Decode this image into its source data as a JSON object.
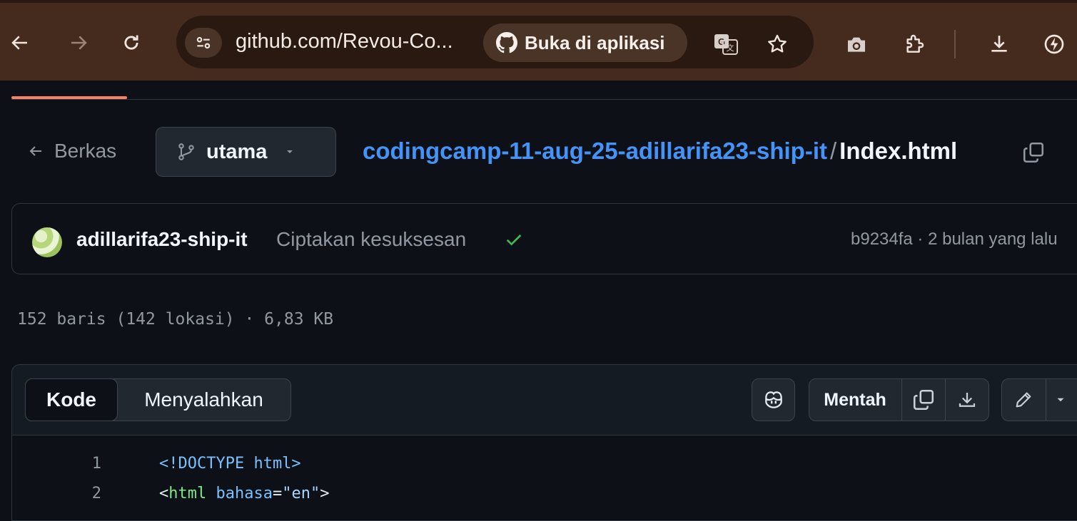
{
  "browser": {
    "url": "github.com/Revou-Co...",
    "open_in_app": "Buka di aplikasi"
  },
  "repo_header": {
    "back_label": "Berkas",
    "branch": "utama",
    "repo_name": "codingcamp-11-aug-25-adillarifa23-ship-it",
    "separator": "/",
    "file_name": "Index.html"
  },
  "latest_commit": {
    "author": "adillarifa23-ship-it",
    "message": "Ciptakan kesuksesan",
    "meta": "b9234fa · 2 bulan yang lalu"
  },
  "file_stats": "152 baris (142 lokasi) · 6,83 KB",
  "file_view": {
    "tabs": [
      {
        "label": "Kode",
        "active": true
      },
      {
        "label": "Menyalahkan",
        "active": false
      }
    ],
    "raw_label": "Mentah"
  },
  "code_lines": [
    {
      "number": "1",
      "tokens": [
        {
          "text": "<!DOCTYPE html>",
          "kind": "doctype"
        }
      ]
    },
    {
      "number": "2",
      "tokens": [
        {
          "text": "<",
          "kind": "punc"
        },
        {
          "text": "html",
          "kind": "tag"
        },
        {
          "text": " ",
          "kind": "punc"
        },
        {
          "text": "bahasa",
          "kind": "attr"
        },
        {
          "text": "=",
          "kind": "punc"
        },
        {
          "text": "\"en\"",
          "kind": "str"
        },
        {
          "text": ">",
          "kind": "punc"
        }
      ]
    }
  ],
  "colors": {
    "browser_frame": "#442b1e",
    "page_bg": "#0d1117",
    "link_blue": "#4493f8",
    "success_green": "#3fb950",
    "tab_accent": "#f78166"
  },
  "icons": {
    "back": "arrow-left-icon",
    "forward": "arrow-right-icon",
    "reload": "reload-icon",
    "site_info": "tune-icon",
    "github": "github-logo-icon",
    "translate": "translate-icon",
    "bookmark": "star-icon",
    "camera": "camera-icon",
    "extensions": "puzzle-icon",
    "download": "download-icon",
    "performance": "performance-icon",
    "branch": "git-branch-icon",
    "copy": "copy-icon",
    "check": "check-icon",
    "copilot": "copilot-icon",
    "edit": "pencil-icon",
    "dropdown": "triangle-down-icon"
  }
}
